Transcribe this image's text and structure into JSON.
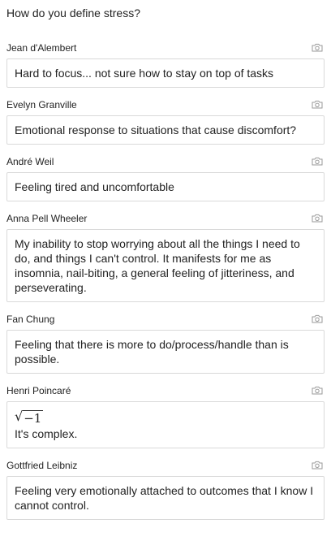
{
  "question": "How do you define stress?",
  "responses": [
    {
      "author": "Jean d'Alembert",
      "text": "Hard to focus... not sure how to stay on top of tasks"
    },
    {
      "author": "Evelyn Granville",
      "text": "Emotional response to situations that cause discomfort?"
    },
    {
      "author": "André Weil",
      "text": "Feeling tired and uncomfortable"
    },
    {
      "author": "Anna Pell Wheeler",
      "text": "My inability to stop worrying about all the things I need to do, and things I can't control. It manifests for me as insomnia, nail-biting, a general feeling of jitteriness, and perseverating."
    },
    {
      "author": "Fan Chung",
      "text": "Feeling that there is more to do/process/handle than is possible."
    },
    {
      "author": "Henri Poincaré",
      "math": "−1",
      "text": "It's complex."
    },
    {
      "author": "Gottfried Leibniz",
      "text": "Feeling very emotionally attached to outcomes that I know I cannot control."
    }
  ],
  "icons": {
    "snapshot": "camera-icon"
  },
  "colors": {
    "text": "#222222",
    "border": "#d9d9d9",
    "icon": "#9a9a9a"
  }
}
